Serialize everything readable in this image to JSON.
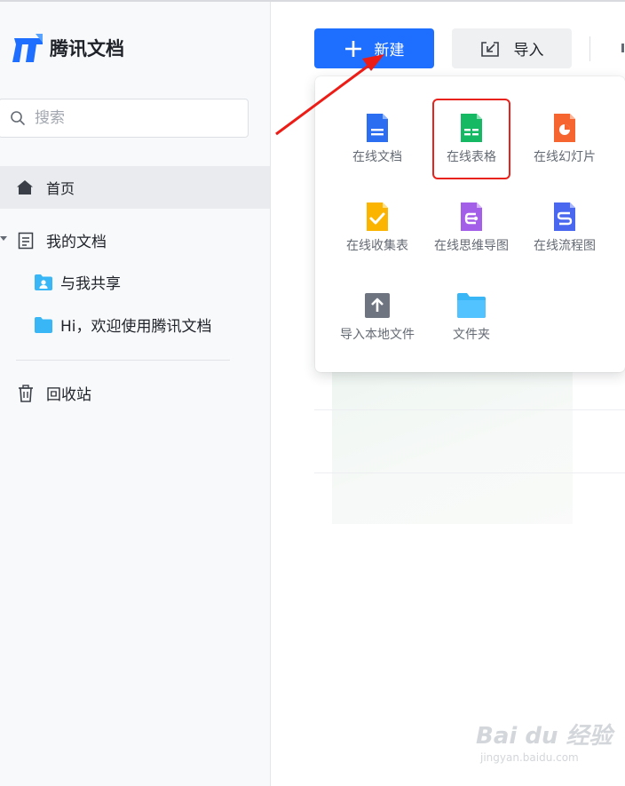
{
  "app": {
    "name": "腾讯文档"
  },
  "sidebar": {
    "search_placeholder": "搜索",
    "home": "首页",
    "my_docs": "我的文档",
    "shared": "与我共享",
    "welcome_folder": "Hi，欢迎使用腾讯文档",
    "trash": "回收站"
  },
  "toolbar": {
    "new_label": "新建",
    "import_label": "导入"
  },
  "new_menu": {
    "items": [
      {
        "label": "在线文档",
        "icon": "doc-icon",
        "color": "#2b6ef2"
      },
      {
        "label": "在线表格",
        "icon": "sheet-icon",
        "color": "#15b963"
      },
      {
        "label": "在线幻灯片",
        "icon": "slide-icon",
        "color": "#f6652f"
      },
      {
        "label": "在线收集表",
        "icon": "form-icon",
        "color": "#fbb500"
      },
      {
        "label": "在线思维导图",
        "icon": "mindmap-icon",
        "color": "#a45fe8"
      },
      {
        "label": "在线流程图",
        "icon": "flowchart-icon",
        "color": "#4a67f0"
      },
      {
        "label": "导入本地文件",
        "icon": "upload-icon",
        "color": "#6e7580"
      },
      {
        "label": "文件夹",
        "icon": "folder-icon",
        "color": "#39b6f5"
      }
    ]
  },
  "watermark": {
    "brand": "Bai du 经验",
    "url": "jingyan.baidu.com"
  },
  "colors": {
    "primary": "#1e6fff",
    "highlight": "#e8221c"
  }
}
